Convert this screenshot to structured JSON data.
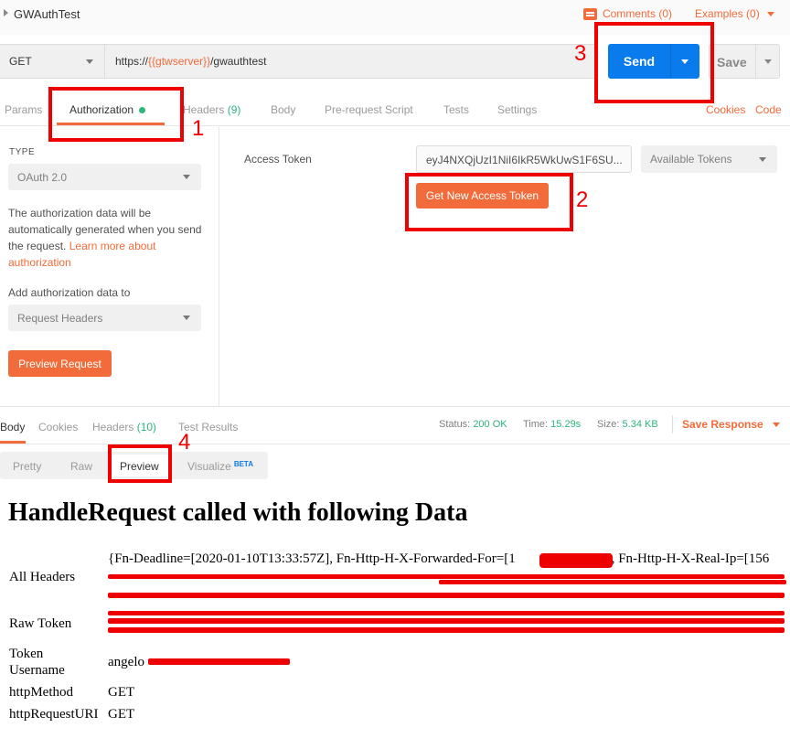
{
  "request": {
    "title": "GWAuthTest",
    "comments": "Comments (0)",
    "examples": "Examples (0)",
    "method": "GET",
    "url_prefix": "https://",
    "url_var": "{{gtwserver}}",
    "url_suffix": "/gwauthtest",
    "send": "Send",
    "save": "Save"
  },
  "tabs": {
    "params": "Params",
    "authorization": "Authorization",
    "headers": "Headers",
    "headers_count": "(9)",
    "body": "Body",
    "prescript": "Pre-request Script",
    "tests": "Tests",
    "settings": "Settings",
    "cookies": "Cookies",
    "code": "Code"
  },
  "auth": {
    "type_label": "TYPE",
    "type_value": "OAuth 2.0",
    "desc": "The authorization data will be automatically generated when you send the request. ",
    "learn_more": "Learn more about authorization",
    "add_to_label": "Add authorization data to",
    "add_to_value": "Request Headers",
    "preview_button": "Preview Request",
    "access_token_label": "Access Token",
    "access_token_value": "eyJ4NXQjUzI1NiI6IkR5WkUwS1F6SU...",
    "available_tokens": "Available Tokens",
    "get_new_token": "Get New Access Token"
  },
  "response": {
    "tabs": {
      "body": "Body",
      "cookies": "Cookies",
      "headers": "Headers",
      "headers_count": "(10)",
      "test_results": "Test Results"
    },
    "status_label": "Status:",
    "status_value": "200 OK",
    "time_label": "Time:",
    "time_value": "15.29s",
    "size_label": "Size:",
    "size_value": "5.34 KB",
    "save_response": "Save Response",
    "views": {
      "pretty": "Pretty",
      "raw": "Raw",
      "preview": "Preview",
      "visualize": "Visualize",
      "beta": "BETA"
    }
  },
  "preview": {
    "heading": "HandleRequest called with following Data",
    "rows": [
      {
        "key": "All Headers",
        "value": "{Fn-Deadline=[2020-01-10T13:33:57Z], Fn-Http-H-X-Forwarded-For=[1",
        "value2": "], Fn-Http-H-X-Real-Ip=[156"
      },
      {
        "key": "Raw Token",
        "value": ""
      },
      {
        "key": "Token Username",
        "value": "angelo"
      },
      {
        "key": "httpMethod",
        "value": "GET"
      },
      {
        "key": "httpRequestURI",
        "value": "GET"
      }
    ],
    "token_key_line1": "Token",
    "token_key_line2": "Username"
  },
  "annotations": [
    "1",
    "2",
    "3",
    "4"
  ],
  "colors": {
    "accent": "#f26b3a",
    "send_blue": "#097bed",
    "success_green": "#2eb67d",
    "annotation_red": "#ee0000"
  }
}
